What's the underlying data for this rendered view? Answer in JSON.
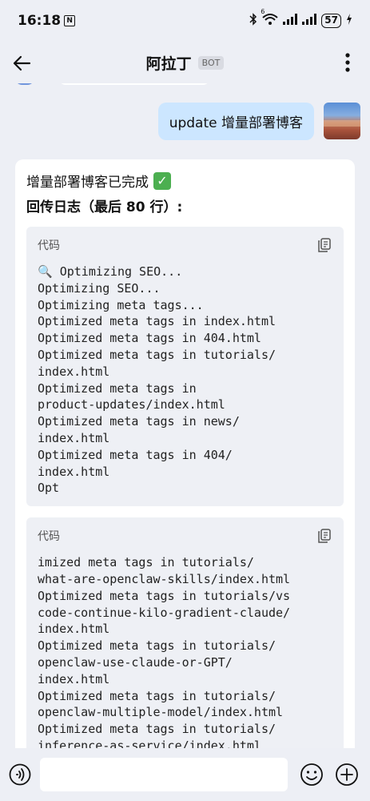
{
  "status_bar": {
    "time": "16:18",
    "nfc_glyph": "N",
    "wifi_label": "6",
    "battery": "57",
    "icons": [
      "nfc-icon",
      "bluetooth-icon",
      "wifi-icon",
      "signal-icon",
      "signal-icon",
      "battery-icon",
      "charging-icon"
    ]
  },
  "header": {
    "title": "阿拉丁",
    "badge": "BOT",
    "back_icon": "back-arrow-icon",
    "more_icon": "more-vertical-icon"
  },
  "messages": {
    "user": {
      "text": "update 增量部署博客"
    },
    "bot": {
      "line1": "增量部署博客已完成",
      "check_icon": "✓",
      "line2": "回传日志（最后 80 行）:",
      "code_blocks": [
        {
          "lang": "代码",
          "content": "🔍 Optimizing SEO...\nOptimizing SEO...\nOptimizing meta tags...\nOptimized meta tags in index.html\nOptimized meta tags in 404.html\nOptimized meta tags in tutorials/\nindex.html\nOptimized meta tags in\nproduct-updates/index.html\nOptimized meta tags in news/\nindex.html\nOptimized meta tags in 404/\nindex.html\nOpt"
        },
        {
          "lang": "代码",
          "content": "imized meta tags in tutorials/\nwhat-are-openclaw-skills/index.html\nOptimized meta tags in tutorials/vs\ncode-continue-kilo-gradient-claude/\nindex.html\nOptimized meta tags in tutorials/\nopenclaw-use-claude-or-GPT/\nindex.html\nOptimized meta tags in tutorials/\nopenclaw-multiple-model/index.html\nOptimized meta tags in tutorials/\ninference-as-service/index.html"
        }
      ]
    }
  },
  "input_bar": {
    "placeholder": "",
    "voice_icon": "voice-icon",
    "emoji_icon": "emoji-icon",
    "plus_icon": "plus-icon"
  }
}
